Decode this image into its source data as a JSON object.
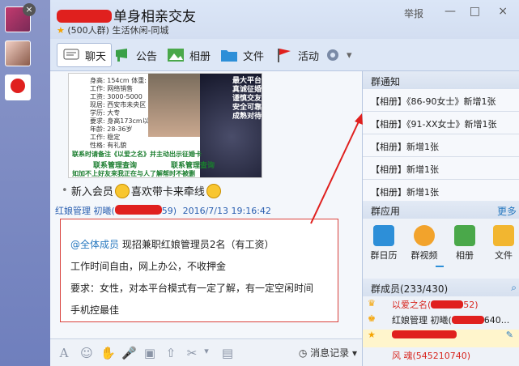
{
  "window": {
    "title": "单身相亲交友",
    "subtitle": "(500人群) 生活休闲-同城",
    "report_label": "举报",
    "minimize": "—",
    "maximize": "□",
    "close": "×"
  },
  "tabs": [
    {
      "label": "聊天",
      "icon": "chat-icon"
    },
    {
      "label": "公告",
      "icon": "announcement-icon"
    },
    {
      "label": "相册",
      "icon": "album-icon"
    },
    {
      "label": "文件",
      "icon": "folder-icon"
    },
    {
      "label": "活动",
      "icon": "flag-icon"
    },
    {
      "label": "",
      "icon": "gear-icon"
    }
  ],
  "poster": {
    "slogans": [
      "最大平台",
      "真诚征婚",
      "谨慎交友",
      "安全可靠",
      "成熟对待"
    ],
    "green_line1": "联系时请备注《以爱之名》并主动出示征婚卡",
    "green_line2": "联系管理查询",
    "green_line3": "联系管理查询",
    "green_line4": "如加不上好友来我正在与人了解帮时不被删"
  },
  "system_message": {
    "text": "新入会员",
    "text2": "喜欢带卡来牵线"
  },
  "message": {
    "sender": "红娘管理 初曦(",
    "sender_suffix": "59)",
    "timestamp": "2016/7/13 19:16:42",
    "mention": "@全体成员",
    "line1": "现招兼职红娘管理员2名（有工资）",
    "line2": "工作时间自由，网上办公，不收押金",
    "line3": "要求：女性，对本平台模式有一定了解，有一定空闲时间",
    "line4": "手机控最佳"
  },
  "composer": {
    "history_label": "消息记录",
    "icons": [
      "font-icon",
      "emoji-icon",
      "vibrate-icon",
      "voice-icon",
      "image-icon",
      "upload-icon",
      "scissors-icon",
      "dropdown-icon"
    ]
  },
  "right_panel": {
    "notice_header": "群通知",
    "notices": [
      "【相册】《86-90女士》新增1张",
      "【相册】《91-XX女士》新增1张",
      "【相册】新增1张",
      "【相册】新增1张",
      "【相册】新增1张"
    ],
    "apps_header": "群应用",
    "apps_more": "更多",
    "apps": [
      {
        "label": "群日历",
        "icon": "calendar-icon",
        "color": "#2d8fd8"
      },
      {
        "label": "群视频",
        "icon": "video-icon",
        "color": "#f2a32c"
      },
      {
        "label": "相册",
        "icon": "album-icon",
        "color": "#4aa84a"
      },
      {
        "label": "文件",
        "icon": "folder-icon",
        "color": "#f2b630"
      }
    ],
    "members_header": "群成员(233/430)",
    "members": [
      {
        "name": "以爱之名(",
        "suffix": "52)",
        "color": "#d8261f"
      },
      {
        "name": "红娘管理  初曦(",
        "suffix": "640...",
        "color": "#222"
      },
      {
        "name": "",
        "suffix": "",
        "color": "#222"
      },
      {
        "name": "风 魂(545210740)",
        "suffix": "",
        "color": "#d8261f"
      },
      {
        "name": "",
        "suffix": "",
        "color": "#d8261f"
      }
    ]
  },
  "colors": {
    "accent_red": "#e0201e",
    "link_blue": "#2a5fb0",
    "panel_bg": "#eef2f8"
  }
}
